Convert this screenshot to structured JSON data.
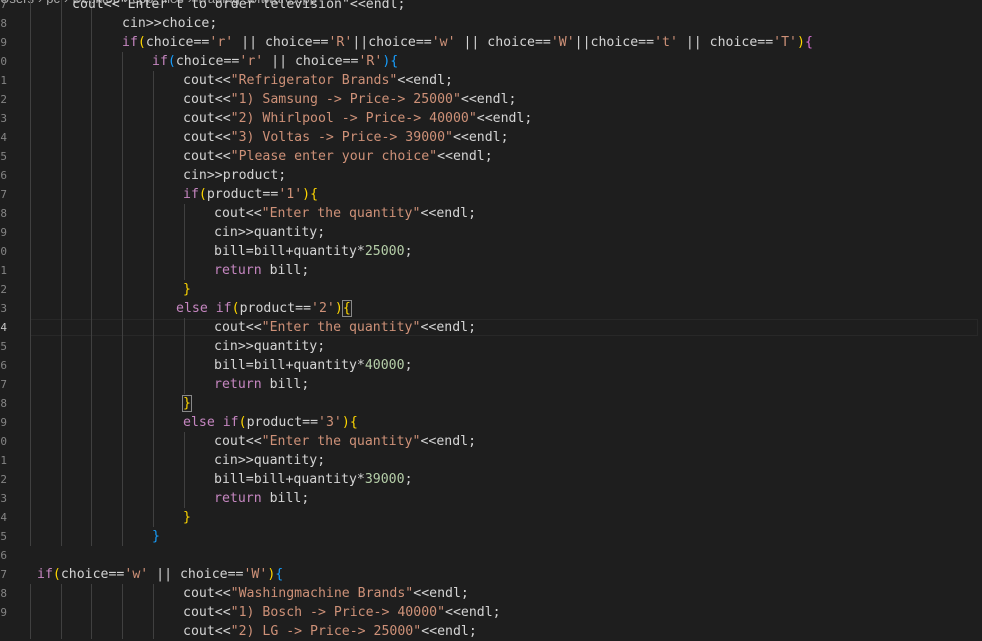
{
  "breadcrumb": {
    "segments": [
      "Users",
      "pc",
      "Desktop",
      "cpp_files",
      "Trading software.cpp"
    ],
    "separator": "›"
  },
  "editor": {
    "line_numbers": [
      "7",
      "8",
      "9",
      "0",
      "1",
      "2",
      "3",
      "4",
      "5",
      "6",
      "7",
      "8",
      "9",
      "0",
      "1",
      "2",
      "3",
      "4",
      "5",
      "6",
      "7",
      "8",
      "9",
      "0",
      "1",
      "2",
      "3",
      "4",
      "5",
      "6",
      "7",
      "8",
      "9"
    ],
    "current_line_number": "3",
    "lines": [
      {
        "indent": 72,
        "tokens": [
          {
            "t": "cout<<\"Enter t to order television\"<<endl;",
            "c": "id"
          }
        ]
      },
      {
        "indent": 122,
        "tokens": [
          {
            "t": "cin>>choice;",
            "c": "id"
          }
        ]
      },
      {
        "indent": 122,
        "tokens": [
          {
            "t": "if",
            "c": "kw"
          },
          {
            "t": "(",
            "c": "p1"
          },
          {
            "t": "choice==",
            "c": "id"
          },
          {
            "t": "'r'",
            "c": "str"
          },
          {
            "t": " || choice==",
            "c": "id"
          },
          {
            "t": "'R'",
            "c": "str"
          },
          {
            "t": "||choice==",
            "c": "id"
          },
          {
            "t": "'w'",
            "c": "str"
          },
          {
            "t": " || choice==",
            "c": "id"
          },
          {
            "t": "'W'",
            "c": "str"
          },
          {
            "t": "||choice==",
            "c": "id"
          },
          {
            "t": "'t'",
            "c": "str"
          },
          {
            "t": " || choice==",
            "c": "id"
          },
          {
            "t": "'T'",
            "c": "str"
          },
          {
            "t": ")",
            "c": "p1"
          },
          {
            "t": "{",
            "c": "p2"
          }
        ]
      },
      {
        "indent": 152,
        "tokens": [
          {
            "t": "if",
            "c": "kw"
          },
          {
            "t": "(",
            "c": "p3"
          },
          {
            "t": "choice==",
            "c": "id"
          },
          {
            "t": "'r'",
            "c": "str"
          },
          {
            "t": " || choice==",
            "c": "id"
          },
          {
            "t": "'R'",
            "c": "str"
          },
          {
            "t": ")",
            "c": "p3"
          },
          {
            "t": "{",
            "c": "p3"
          }
        ]
      },
      {
        "indent": 183,
        "tokens": [
          {
            "t": "cout<<",
            "c": "id"
          },
          {
            "t": "\"Refrigerator Brands\"",
            "c": "str"
          },
          {
            "t": "<<endl;",
            "c": "id"
          }
        ]
      },
      {
        "indent": 183,
        "tokens": [
          {
            "t": "cout<<",
            "c": "id"
          },
          {
            "t": "\"1) Samsung -> Price-> 25000\"",
            "c": "str"
          },
          {
            "t": "<<endl;",
            "c": "id"
          }
        ]
      },
      {
        "indent": 183,
        "tokens": [
          {
            "t": "cout<<",
            "c": "id"
          },
          {
            "t": "\"2) Whirlpool -> Price-> 40000\"",
            "c": "str"
          },
          {
            "t": "<<endl;",
            "c": "id"
          }
        ]
      },
      {
        "indent": 183,
        "tokens": [
          {
            "t": "cout<<",
            "c": "id"
          },
          {
            "t": "\"3) Voltas -> Price-> 39000\"",
            "c": "str"
          },
          {
            "t": "<<endl;",
            "c": "id"
          }
        ]
      },
      {
        "indent": 183,
        "tokens": [
          {
            "t": "cout<<",
            "c": "id"
          },
          {
            "t": "\"Please enter your choice\"",
            "c": "str"
          },
          {
            "t": "<<endl;",
            "c": "id"
          }
        ]
      },
      {
        "indent": 183,
        "tokens": [
          {
            "t": "cin>>product;",
            "c": "id"
          }
        ]
      },
      {
        "indent": 183,
        "tokens": [
          {
            "t": "if",
            "c": "kw"
          },
          {
            "t": "(",
            "c": "p1"
          },
          {
            "t": "product==",
            "c": "id"
          },
          {
            "t": "'1'",
            "c": "str"
          },
          {
            "t": ")",
            "c": "p1"
          },
          {
            "t": "{",
            "c": "p1"
          }
        ]
      },
      {
        "indent": 214,
        "tokens": [
          {
            "t": "cout<<",
            "c": "id"
          },
          {
            "t": "\"Enter the quantity\"",
            "c": "str"
          },
          {
            "t": "<<endl;",
            "c": "id"
          }
        ]
      },
      {
        "indent": 214,
        "tokens": [
          {
            "t": "cin>>quantity;",
            "c": "id"
          }
        ]
      },
      {
        "indent": 214,
        "tokens": [
          {
            "t": "bill=bill+quantity*",
            "c": "id"
          },
          {
            "t": "25000",
            "c": "num"
          },
          {
            "t": ";",
            "c": "id"
          }
        ]
      },
      {
        "indent": 214,
        "tokens": [
          {
            "t": "return",
            "c": "kw"
          },
          {
            "t": " bill;",
            "c": "id"
          }
        ]
      },
      {
        "indent": 183,
        "tokens": [
          {
            "t": "}",
            "c": "p1"
          }
        ]
      },
      {
        "indent": 176,
        "tokens": [
          {
            "t": "else",
            "c": "kw"
          },
          {
            "t": " ",
            "c": "id"
          },
          {
            "t": "if",
            "c": "kw"
          },
          {
            "t": "(",
            "c": "p1"
          },
          {
            "t": "product==",
            "c": "id"
          },
          {
            "t": "'2'",
            "c": "str"
          },
          {
            "t": ")",
            "c": "p1"
          },
          {
            "t": "{",
            "c": "p1",
            "bm": true
          }
        ]
      },
      {
        "indent": 214,
        "tokens": [
          {
            "t": "cout<<",
            "c": "id"
          },
          {
            "t": "\"Enter the quantity\"",
            "c": "str"
          },
          {
            "t": "<<endl;",
            "c": "id"
          }
        ]
      },
      {
        "indent": 214,
        "tokens": [
          {
            "t": "cin>>quantity;",
            "c": "id"
          }
        ]
      },
      {
        "indent": 214,
        "tokens": [
          {
            "t": "bill=bill+quantity*",
            "c": "id"
          },
          {
            "t": "40000",
            "c": "num"
          },
          {
            "t": ";",
            "c": "id"
          }
        ]
      },
      {
        "indent": 214,
        "tokens": [
          {
            "t": "return",
            "c": "kw"
          },
          {
            "t": " bill;",
            "c": "id"
          }
        ]
      },
      {
        "indent": 183,
        "tokens": [
          {
            "t": "}",
            "c": "p1",
            "bm": true
          }
        ]
      },
      {
        "indent": 183,
        "tokens": [
          {
            "t": "else",
            "c": "kw"
          },
          {
            "t": " ",
            "c": "id"
          },
          {
            "t": "if",
            "c": "kw"
          },
          {
            "t": "(",
            "c": "p1"
          },
          {
            "t": "product==",
            "c": "id"
          },
          {
            "t": "'3'",
            "c": "str"
          },
          {
            "t": ")",
            "c": "p1"
          },
          {
            "t": "{",
            "c": "p1"
          }
        ]
      },
      {
        "indent": 214,
        "tokens": [
          {
            "t": "cout<<",
            "c": "id"
          },
          {
            "t": "\"Enter the quantity\"",
            "c": "str"
          },
          {
            "t": "<<endl;",
            "c": "id"
          }
        ]
      },
      {
        "indent": 214,
        "tokens": [
          {
            "t": "cin>>quantity;",
            "c": "id"
          }
        ]
      },
      {
        "indent": 214,
        "tokens": [
          {
            "t": "bill=bill+quantity*",
            "c": "id"
          },
          {
            "t": "39000",
            "c": "num"
          },
          {
            "t": ";",
            "c": "id"
          }
        ]
      },
      {
        "indent": 214,
        "tokens": [
          {
            "t": "return",
            "c": "kw"
          },
          {
            "t": " bill;",
            "c": "id"
          }
        ]
      },
      {
        "indent": 183,
        "tokens": [
          {
            "t": "}",
            "c": "p1"
          }
        ]
      },
      {
        "indent": 152,
        "tokens": [
          {
            "t": "}",
            "c": "p3"
          }
        ]
      },
      {
        "indent": 0,
        "tokens": []
      },
      {
        "indent": 37,
        "tokens": [
          {
            "t": "if",
            "c": "kw"
          },
          {
            "t": "(",
            "c": "p1"
          },
          {
            "t": "choice==",
            "c": "id"
          },
          {
            "t": "'w'",
            "c": "str"
          },
          {
            "t": " || choice==",
            "c": "id"
          },
          {
            "t": "'W'",
            "c": "str"
          },
          {
            "t": ")",
            "c": "p1"
          },
          {
            "t": "{",
            "c": "p3"
          }
        ]
      },
      {
        "indent": 183,
        "tokens": [
          {
            "t": "cout<<",
            "c": "id"
          },
          {
            "t": "\"Washingmachine Brands\"",
            "c": "str"
          },
          {
            "t": "<<endl;",
            "c": "id"
          }
        ]
      },
      {
        "indent": 183,
        "tokens": [
          {
            "t": "cout<<",
            "c": "id"
          },
          {
            "t": "\"1) Bosch -> Price-> 40000\"",
            "c": "str"
          },
          {
            "t": "<<endl;",
            "c": "id"
          }
        ]
      },
      {
        "indent": 183,
        "tokens": [
          {
            "t": "cout<<",
            "c": "id"
          },
          {
            "t": "\"2) LG -> Price-> 25000\"",
            "c": "str"
          },
          {
            "t": "<<endl;",
            "c": "id"
          }
        ]
      }
    ]
  },
  "colors": {
    "background": "#1e1e1e",
    "keyword": "#c586c0",
    "string": "#ce9178",
    "number": "#b5cea8",
    "identifier": "#d4d4d4",
    "bracket_level1": "#ffd700",
    "bracket_level2": "#da70d6",
    "bracket_level3": "#179fff"
  }
}
